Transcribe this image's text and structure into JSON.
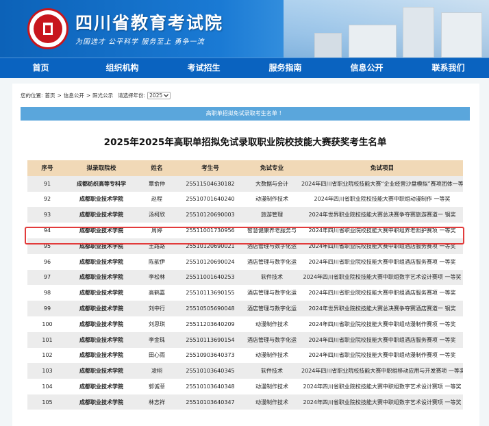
{
  "header": {
    "site_title": "四川省教育考试院",
    "slogan": "为国选才  公平科学  服务至上  勇争一流"
  },
  "nav": [
    "首页",
    "组织机构",
    "考试招生",
    "服务指南",
    "信息公开",
    "联系我们"
  ],
  "breadcrumb": {
    "prefix": "您的位置:",
    "path": [
      "首页",
      "信息公开",
      "阳光公示"
    ],
    "year_label": "请选择年份:",
    "year_value": "2025"
  },
  "notice": "高职单招拟免试录取考生名单 ！",
  "doc_title": "2025年2025年高职单招拟免试录取职业院校技能大赛获奖考生名单",
  "table": {
    "headers": [
      "序号",
      "拟录取院校",
      "姓名",
      "考生号",
      "免试专业",
      "免试项目"
    ],
    "rows": [
      [
        "91",
        "成都纺织高等专科学",
        "覃俞仲",
        "25511504630182",
        "大数据与会计",
        "2024年四川省职业院校技能大赛“企业经营沙盘模拟”赛项团体一等"
      ],
      [
        "92",
        "成都职业技术学院",
        "赵程",
        "25510701640240",
        "动漫制作技术",
        "2024年四川省职业院校技能大赛中职组动漫制作 一等奖"
      ],
      [
        "93",
        "成都职业技术学院",
        "汤柯欣",
        "25510120690003",
        "旅游管理",
        "2024年世界职业院校技能大赛总决赛争夺赛旅游赛道一 铜奖"
      ],
      [
        "94",
        "成都职业技术学院",
        "周婷",
        "25511001730956",
        "智慧健康养老服务与",
        "2024年四川省职业院校技能大赛中职组养老照护赛项 一等奖"
      ],
      [
        "95",
        "成都职业技术学院",
        "王路路",
        "25510120690021",
        "酒店管理与数字化运",
        "2024年四川省职业院校技能大赛中职组酒店服务赛项 一等奖"
      ],
      [
        "96",
        "成都职业技术学院",
        "陈歆伊",
        "25510120690024",
        "酒店管理与数字化运",
        "2024年四川省职业院校技能大赛中职组酒店服务赛项 一等奖"
      ],
      [
        "97",
        "成都职业技术学院",
        "李松林",
        "25511001640253",
        "软件技术",
        "2024年四川省职业院校技能大赛中职组数字艺术设计赛项 一等奖"
      ],
      [
        "98",
        "成都职业技术学院",
        "高鹤嘉",
        "25510113690155",
        "酒店管理与数字化运",
        "2024年四川省职业院校技能大赛中职组酒店服务赛项 一等奖"
      ],
      [
        "99",
        "成都职业技术学院",
        "刘中行",
        "25510505690048",
        "酒店管理与数字化运",
        "2024年世界职业院校技能大赛总决赛争夺赛酒店赛道一 铜奖"
      ],
      [
        "100",
        "成都职业技术学院",
        "刘思琪",
        "25511203640209",
        "动漫制作技术",
        "2024年四川省职业院校技能大赛中职组动漫制作赛项 一等奖"
      ],
      [
        "101",
        "成都职业技术学院",
        "李金珠",
        "25510113690154",
        "酒店管理与数字化运",
        "2024年四川省职业院校技能大赛中职组酒店服务赛项 一等奖"
      ],
      [
        "102",
        "成都职业技术学院",
        "田心雨",
        "25510903640373",
        "动漫制作技术",
        "2024年四川省职业院校技能大赛中职组动漫制作赛项 一等奖"
      ],
      [
        "103",
        "成都职业技术学院",
        "凌栩",
        "25510103640345",
        "软件技术",
        "2024年四川省职业院校技能大赛中职组移动应用与开发赛项 一等奖"
      ],
      [
        "104",
        "成都职业技术学院",
        "郭诚菲",
        "25510103640348",
        "动漫制作技术",
        "2024年四川省职业院校技能大赛中职组数字艺术设计赛项 一等奖"
      ],
      [
        "105",
        "成都职业技术学院",
        "林志祥",
        "25510103640347",
        "动漫制作技术",
        "2024年四川省职业院校技能大赛中职组数字艺术设计赛项 一等奖"
      ]
    ]
  },
  "colors": {
    "nav_bg": "#0a63c0",
    "table_header_bg": "#f1d9b7",
    "notice_bg": "#5aa6dc",
    "highlight_border": "#e23b3b"
  }
}
